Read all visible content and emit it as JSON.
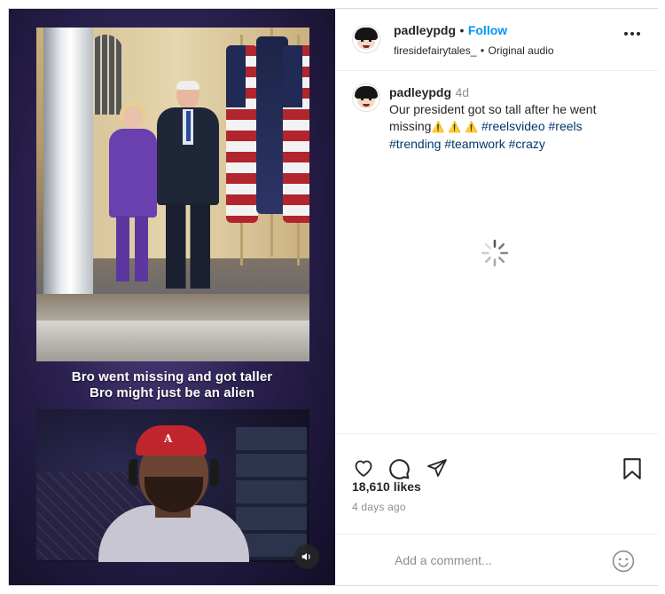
{
  "post": {
    "username": "padleypdg",
    "separator": "•",
    "follow_label": "Follow",
    "audio_owner": "firesidefairytales_",
    "audio_separator": "•",
    "audio_label": "Original audio",
    "time_inline": "4d",
    "caption": {
      "text": "Our president got so tall after he went missing",
      "warnings": [
        "⚠️",
        "⚠️",
        "⚠️"
      ],
      "hashtags": [
        "#reelsvideo",
        "#reels",
        "#trending",
        "#teamwork",
        "#crazy"
      ]
    },
    "likes": "18,610 likes",
    "posted_ago": "4 days ago"
  },
  "video": {
    "subtitle_line1": "Bro went missing and got taller",
    "subtitle_line2": "Bro might just be an alien",
    "cap_letter": "A"
  },
  "comment_box": {
    "placeholder": "Add a comment..."
  },
  "icons": {
    "more": "more-options-icon",
    "like": "heart-icon",
    "comment": "comment-icon",
    "share": "share-icon",
    "save": "bookmark-icon",
    "mute": "speaker-icon",
    "emoji": "emoji-icon",
    "loading": "spinner-icon"
  },
  "colors": {
    "follow": "#0095f6",
    "hashtag": "#00376b",
    "muted_text": "#8e8e8e"
  }
}
